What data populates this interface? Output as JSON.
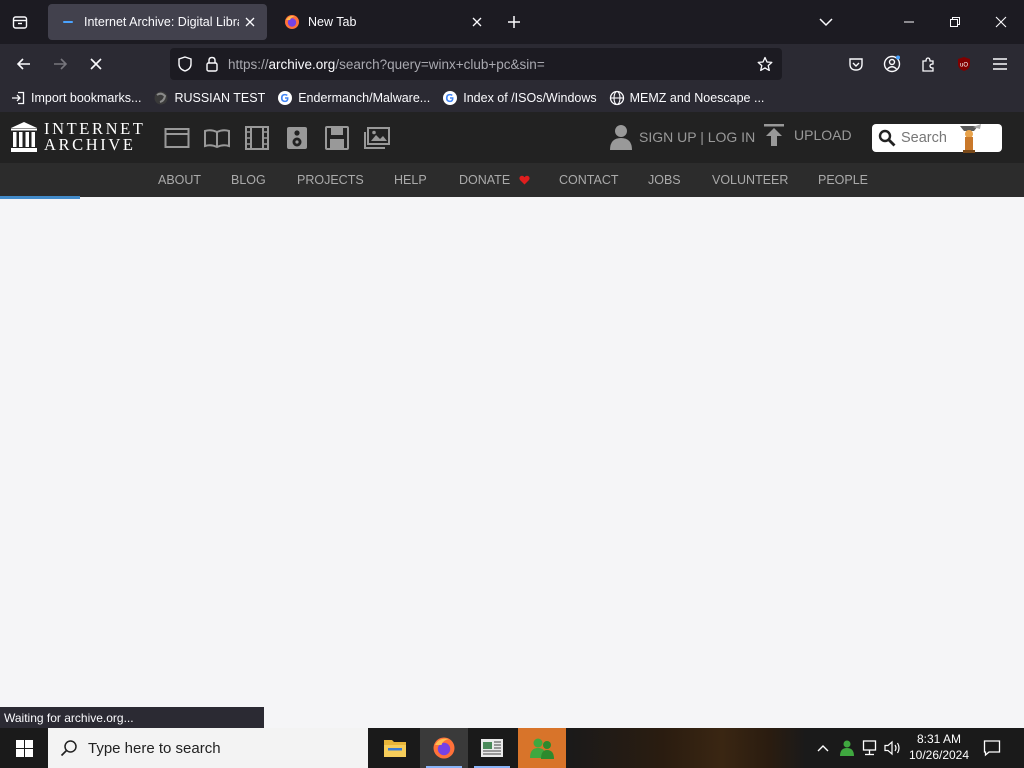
{
  "browser": {
    "tabs": [
      {
        "title": "Internet Archive: Digital Library",
        "active": true
      },
      {
        "title": "New Tab",
        "active": false
      }
    ],
    "url": {
      "scheme": "https://",
      "host": "archive.org",
      "path": "/search?query=winx+club+pc&sin="
    },
    "bookmarks": [
      {
        "label": "Import bookmarks...",
        "icon": "import-icon"
      },
      {
        "label": "RUSSIAN TEST",
        "icon": "site-icon"
      },
      {
        "label": "Endermanch/Malware...",
        "icon": "google-icon"
      },
      {
        "label": "Index of /ISOs/Windows",
        "icon": "google-icon"
      },
      {
        "label": "MEMZ and Noescape ...",
        "icon": "globe-icon"
      }
    ],
    "status": "Waiting for archive.org...",
    "loading": true
  },
  "archive": {
    "logo_line1": "INTERNET",
    "logo_line2": "ARCHIVE",
    "media_icons": [
      "web-icon",
      "texts-icon",
      "video-icon",
      "audio-icon",
      "software-icon",
      "images-icon"
    ],
    "signup_label": "SIGN UP | LOG IN",
    "upload_label": "UPLOAD",
    "search_placeholder": "Search",
    "nav": [
      "ABOUT",
      "BLOG",
      "PROJECTS",
      "HELP",
      "DONATE",
      "CONTACT",
      "JOBS",
      "VOLUNTEER",
      "PEOPLE"
    ]
  },
  "taskbar": {
    "search_placeholder": "Type here to search",
    "apps": [
      "file-explorer",
      "firefox",
      "news-app",
      "chat-app"
    ],
    "time": "8:31 AM",
    "date": "10/26/2024"
  },
  "colors": {
    "accent": "#428bca",
    "donate_heart": "#e01e1e"
  }
}
